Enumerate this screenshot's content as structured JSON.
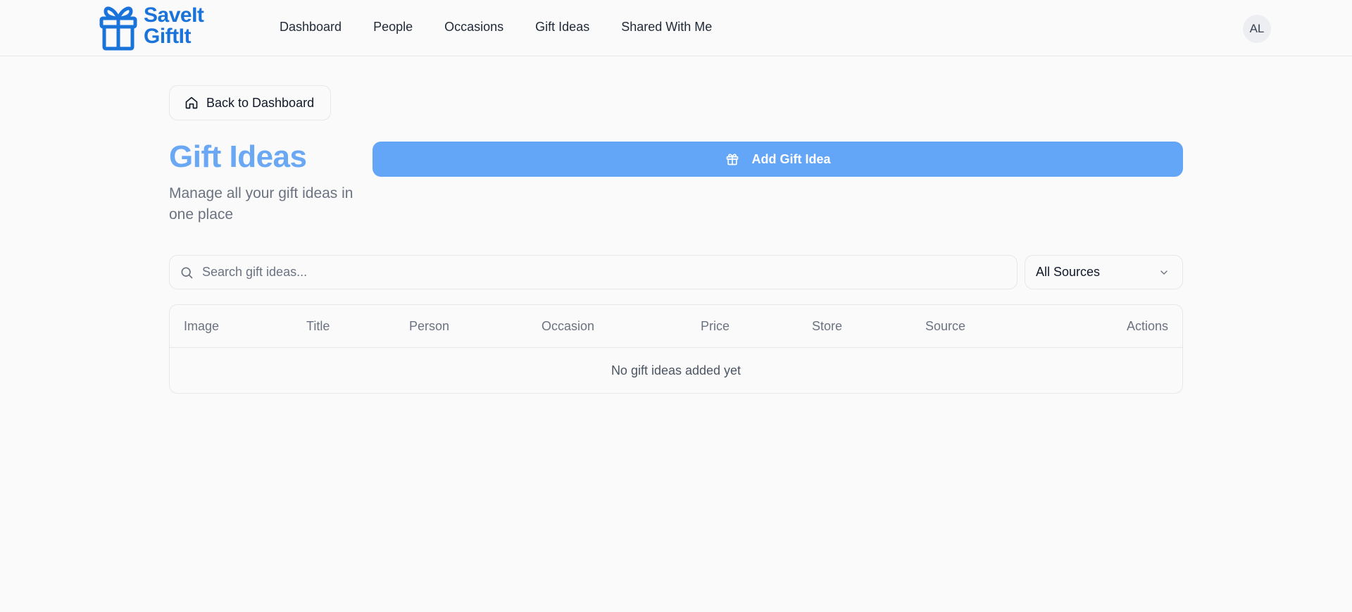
{
  "brand": {
    "line1": "SaveIt",
    "line2": "GiftIt",
    "color": "#1a73d9"
  },
  "nav": {
    "items": [
      "Dashboard",
      "People",
      "Occasions",
      "Gift Ideas",
      "Shared With Me"
    ]
  },
  "user": {
    "initials": "AL"
  },
  "back_button": {
    "label": "Back to Dashboard",
    "icon": "home-icon"
  },
  "page": {
    "title": "Gift Ideas",
    "subtitle": "Manage all your gift ideas in one place",
    "title_color": "#6aa8f4"
  },
  "add_button": {
    "label": "Add Gift Idea",
    "icon": "gift-icon",
    "color": "#63a5f7"
  },
  "search": {
    "placeholder": "Search gift ideas...",
    "value": "",
    "icon": "search-icon"
  },
  "source_filter": {
    "selected": "All Sources",
    "icon": "chevron-down-icon"
  },
  "table": {
    "columns": [
      "Image",
      "Title",
      "Person",
      "Occasion",
      "Price",
      "Store",
      "Source",
      "Actions"
    ],
    "rows": [],
    "empty_message": "No gift ideas added yet"
  }
}
